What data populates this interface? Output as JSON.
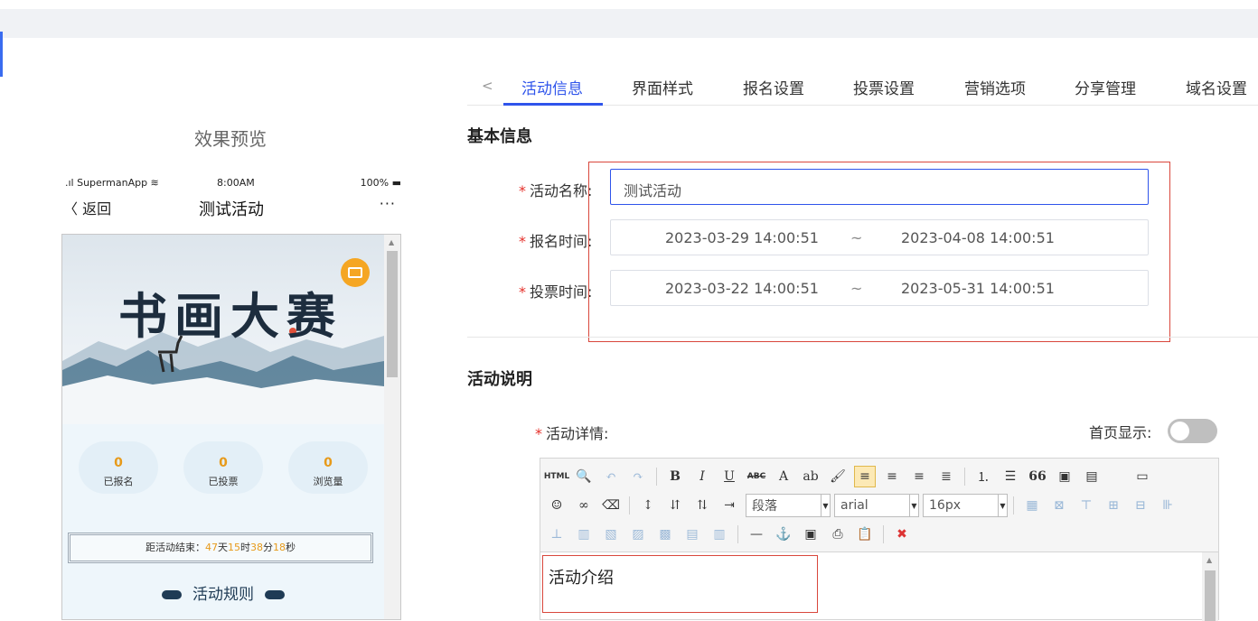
{
  "preview": {
    "title": "效果预览",
    "status_left": ".ıl SupermanApp ≋",
    "status_time": "8:00AM",
    "status_battery": "100% ▬",
    "back_label": "〈 返回",
    "phone_title": "测试活动",
    "more_label": "···",
    "banner_title": "书画大赛",
    "stats": [
      {
        "value": "0",
        "label": "已报名"
      },
      {
        "value": "0",
        "label": "已投票"
      },
      {
        "value": "0",
        "label": "浏览量"
      }
    ],
    "countdown": {
      "prefix": "距活动结束：",
      "days": "47",
      "days_unit": "天",
      "hours": "15",
      "hours_unit": "时",
      "minutes": "38",
      "minutes_unit": "分",
      "seconds": "18",
      "seconds_unit": "秒"
    },
    "rules_label": "活动规则"
  },
  "tabs": {
    "prev_label": "<",
    "items": [
      {
        "label": "活动信息",
        "active": true
      },
      {
        "label": "界面样式",
        "active": false
      },
      {
        "label": "报名设置",
        "active": false
      },
      {
        "label": "投票设置",
        "active": false
      },
      {
        "label": "营销选项",
        "active": false
      },
      {
        "label": "分享管理",
        "active": false
      },
      {
        "label": "域名设置",
        "active": false
      }
    ]
  },
  "basic_info": {
    "section_title": "基本信息",
    "name_label": "活动名称:",
    "name_value": "测试活动",
    "signup_label": "报名时间:",
    "signup_start": "2023-03-29 14:00:51",
    "signup_end": "2023-04-08 14:00:51",
    "vote_label": "投票时间:",
    "vote_start": "2023-03-22 14:00:51",
    "vote_end": "2023-05-31 14:00:51",
    "range_separator": "~",
    "required_mark": "*"
  },
  "description": {
    "section_title": "活动说明",
    "detail_label": "活动详情:",
    "homepage_label": "首页显示:",
    "homepage_enabled": false
  },
  "editor": {
    "html_btn": "HTML",
    "bold": "B",
    "italic": "I",
    "underline": "U",
    "strike": "ABC",
    "fontcolor": "A",
    "quote": "66",
    "paragraph": "段落",
    "font": "arial",
    "size": "16px",
    "content": "活动介绍"
  },
  "colors": {
    "accent": "#2f54eb",
    "required": "#e5302a",
    "highlight": "#e79a1a"
  }
}
